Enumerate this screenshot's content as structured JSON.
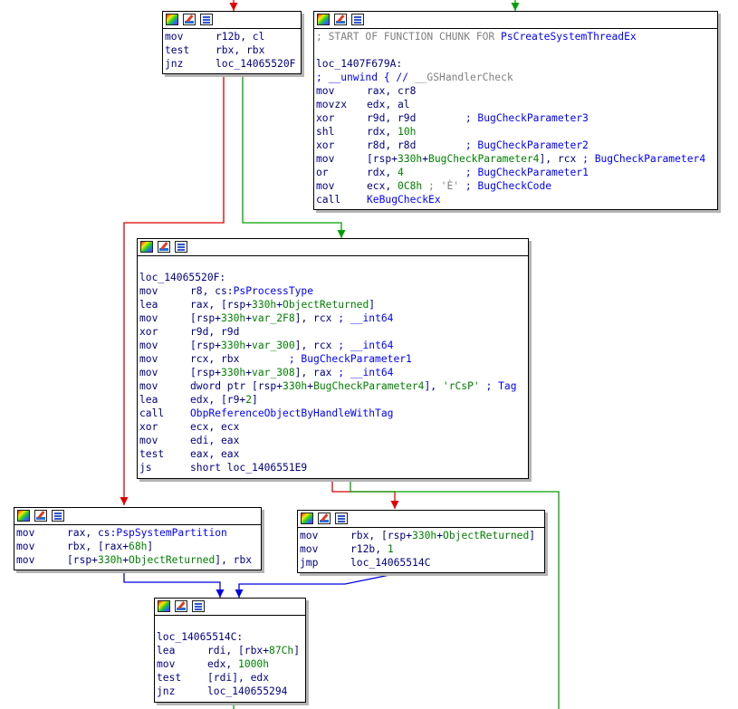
{
  "colors": {
    "edge_true": "#00a000",
    "edge_false": "#e00000",
    "edge_uncond": "#0000e0",
    "edge_entry_green": "#00a000"
  },
  "toolbar_icons": [
    "color-palette-icon",
    "edit-pencil-icon",
    "text-listing-icon"
  ],
  "blocks": {
    "b1": {
      "lines": [
        {
          "mn": "mov",
          "ops": [
            {
              "t": "r12b, cl",
              "c": "op"
            }
          ]
        },
        {
          "mn": "test",
          "ops": [
            {
              "t": "rbx, rbx",
              "c": "op"
            }
          ]
        },
        {
          "mn": "jnz",
          "ops": [
            {
              "t": "loc_14065520F",
              "c": "op"
            }
          ]
        }
      ]
    },
    "b2": {
      "lines": [
        {
          "full": [
            {
              "t": "; START OF FUNCTION CHUNK FOR ",
              "c": "gr"
            },
            {
              "t": "PsCreateSystemThreadEx",
              "c": "sym"
            }
          ]
        },
        {
          "full": []
        },
        {
          "full": [
            {
              "t": "loc_1407F679A:",
              "c": "lbl"
            }
          ]
        },
        {
          "full": [
            {
              "t": "; __unwind { // ",
              "c": "cm"
            },
            {
              "t": "__GSHandlerCheck",
              "c": "gr"
            }
          ]
        },
        {
          "mn": "mov",
          "ops": [
            {
              "t": "rax, cr8",
              "c": "op"
            }
          ]
        },
        {
          "mn": "movzx",
          "ops": [
            {
              "t": "edx, al",
              "c": "op"
            }
          ]
        },
        {
          "mn": "xor",
          "ops": [
            {
              "t": "r9d, r9d        ",
              "c": "op"
            },
            {
              "t": "; BugCheckParameter3",
              "c": "cm"
            }
          ]
        },
        {
          "mn": "shl",
          "ops": [
            {
              "t": "rdx, ",
              "c": "op"
            },
            {
              "t": "10h",
              "c": "nm"
            }
          ]
        },
        {
          "mn": "xor",
          "ops": [
            {
              "t": "r8d, r8d        ",
              "c": "op"
            },
            {
              "t": "; BugCheckParameter2",
              "c": "cm"
            }
          ]
        },
        {
          "mn": "mov",
          "ops": [
            {
              "t": "[rsp+",
              "c": "op"
            },
            {
              "t": "330h",
              "c": "nm"
            },
            {
              "t": "+",
              "c": "op"
            },
            {
              "t": "BugCheckParameter4",
              "c": "nm"
            },
            {
              "t": "], rcx ",
              "c": "op"
            },
            {
              "t": "; BugCheckParameter4",
              "c": "cm"
            }
          ]
        },
        {
          "mn": "or",
          "ops": [
            {
              "t": "rdx, ",
              "c": "op"
            },
            {
              "t": "4",
              "c": "nm"
            },
            {
              "t": "          ",
              "c": "op"
            },
            {
              "t": "; BugCheckParameter1",
              "c": "cm"
            }
          ]
        },
        {
          "mn": "mov",
          "ops": [
            {
              "t": "ecx, ",
              "c": "op"
            },
            {
              "t": "0C8h",
              "c": "nm"
            },
            {
              "t": " ",
              "c": "op"
            },
            {
              "t": "; 'È' ",
              "c": "gr"
            },
            {
              "t": "; BugCheckCode",
              "c": "cm"
            }
          ]
        },
        {
          "mn": "call",
          "ops": [
            {
              "t": "KeBugCheckEx",
              "c": "sym"
            }
          ]
        }
      ]
    },
    "b3": {
      "lines": [
        {
          "full": []
        },
        {
          "full": [
            {
              "t": "loc_14065520F:",
              "c": "lbl"
            }
          ]
        },
        {
          "mn": "mov",
          "ops": [
            {
              "t": "r8, cs:",
              "c": "op"
            },
            {
              "t": "PsProcessType",
              "c": "sym"
            }
          ]
        },
        {
          "mn": "lea",
          "ops": [
            {
              "t": "rax, [rsp+",
              "c": "op"
            },
            {
              "t": "330h",
              "c": "nm"
            },
            {
              "t": "+",
              "c": "op"
            },
            {
              "t": "ObjectReturned",
              "c": "nm"
            },
            {
              "t": "]",
              "c": "op"
            }
          ]
        },
        {
          "mn": "mov",
          "ops": [
            {
              "t": "[rsp+",
              "c": "op"
            },
            {
              "t": "330h",
              "c": "nm"
            },
            {
              "t": "+",
              "c": "op"
            },
            {
              "t": "var_2F8",
              "c": "nm"
            },
            {
              "t": "], rcx ",
              "c": "op"
            },
            {
              "t": "; __int64",
              "c": "cm"
            }
          ]
        },
        {
          "mn": "xor",
          "ops": [
            {
              "t": "r9d, r9d",
              "c": "op"
            }
          ]
        },
        {
          "mn": "mov",
          "ops": [
            {
              "t": "[rsp+",
              "c": "op"
            },
            {
              "t": "330h",
              "c": "nm"
            },
            {
              "t": "+",
              "c": "op"
            },
            {
              "t": "var_300",
              "c": "nm"
            },
            {
              "t": "], rcx ",
              "c": "op"
            },
            {
              "t": "; __int64",
              "c": "cm"
            }
          ]
        },
        {
          "mn": "mov",
          "ops": [
            {
              "t": "rcx, rbx        ",
              "c": "op"
            },
            {
              "t": "; BugCheckParameter1",
              "c": "cm"
            }
          ]
        },
        {
          "mn": "mov",
          "ops": [
            {
              "t": "[rsp+",
              "c": "op"
            },
            {
              "t": "330h",
              "c": "nm"
            },
            {
              "t": "+",
              "c": "op"
            },
            {
              "t": "var_308",
              "c": "nm"
            },
            {
              "t": "], rax ",
              "c": "op"
            },
            {
              "t": "; __int64",
              "c": "cm"
            }
          ]
        },
        {
          "mn": "mov",
          "ops": [
            {
              "t": "dword ptr [rsp+",
              "c": "op"
            },
            {
              "t": "330h",
              "c": "nm"
            },
            {
              "t": "+",
              "c": "op"
            },
            {
              "t": "BugCheckParameter4",
              "c": "nm"
            },
            {
              "t": "], ",
              "c": "op"
            },
            {
              "t": "'rCsP'",
              "c": "str"
            },
            {
              "t": " ",
              "c": "op"
            },
            {
              "t": "; Tag",
              "c": "cm"
            }
          ]
        },
        {
          "mn": "lea",
          "ops": [
            {
              "t": "edx, [r9+",
              "c": "op"
            },
            {
              "t": "2",
              "c": "nm"
            },
            {
              "t": "]",
              "c": "op"
            }
          ]
        },
        {
          "mn": "call",
          "ops": [
            {
              "t": "ObpReferenceObjectByHandleWithTag",
              "c": "sym"
            }
          ]
        },
        {
          "mn": "xor",
          "ops": [
            {
              "t": "ecx, ecx",
              "c": "op"
            }
          ]
        },
        {
          "mn": "mov",
          "ops": [
            {
              "t": "edi, eax",
              "c": "op"
            }
          ]
        },
        {
          "mn": "test",
          "ops": [
            {
              "t": "eax, eax",
              "c": "op"
            }
          ]
        },
        {
          "mn": "js",
          "ops": [
            {
              "t": "short loc_1406551E9",
              "c": "op"
            }
          ]
        }
      ]
    },
    "b4": {
      "lines": [
        {
          "mn": "mov",
          "ops": [
            {
              "t": "rax, cs:",
              "c": "op"
            },
            {
              "t": "PspSystemPartition",
              "c": "sym"
            }
          ]
        },
        {
          "mn": "mov",
          "ops": [
            {
              "t": "rbx, [rax+",
              "c": "op"
            },
            {
              "t": "68h",
              "c": "nm"
            },
            {
              "t": "]",
              "c": "op"
            }
          ]
        },
        {
          "mn": "mov",
          "ops": [
            {
              "t": "[rsp+",
              "c": "op"
            },
            {
              "t": "330h",
              "c": "nm"
            },
            {
              "t": "+",
              "c": "op"
            },
            {
              "t": "ObjectReturned",
              "c": "nm"
            },
            {
              "t": "], rbx",
              "c": "op"
            }
          ]
        }
      ]
    },
    "b5": {
      "lines": [
        {
          "mn": "mov",
          "ops": [
            {
              "t": "rbx, [rsp+",
              "c": "op"
            },
            {
              "t": "330h",
              "c": "nm"
            },
            {
              "t": "+",
              "c": "op"
            },
            {
              "t": "ObjectReturned",
              "c": "nm"
            },
            {
              "t": "]",
              "c": "op"
            }
          ]
        },
        {
          "mn": "mov",
          "ops": [
            {
              "t": "r12b, ",
              "c": "op"
            },
            {
              "t": "1",
              "c": "nm"
            }
          ]
        },
        {
          "mn": "jmp",
          "ops": [
            {
              "t": "loc_14065514C",
              "c": "op"
            }
          ]
        }
      ]
    },
    "b6": {
      "lines": [
        {
          "full": []
        },
        {
          "full": [
            {
              "t": "loc_14065514C:",
              "c": "lbl"
            }
          ]
        },
        {
          "mn": "lea",
          "ops": [
            {
              "t": "rdi, [rbx+",
              "c": "op"
            },
            {
              "t": "87Ch",
              "c": "nm"
            },
            {
              "t": "]",
              "c": "op"
            }
          ]
        },
        {
          "mn": "mov",
          "ops": [
            {
              "t": "edx, ",
              "c": "op"
            },
            {
              "t": "1000h",
              "c": "nm"
            }
          ]
        },
        {
          "mn": "test",
          "ops": [
            {
              "t": "[rdi], edx",
              "c": "op"
            }
          ]
        },
        {
          "mn": "jnz",
          "ops": [
            {
              "t": "loc_140655294",
              "c": "op"
            }
          ]
        }
      ]
    }
  }
}
